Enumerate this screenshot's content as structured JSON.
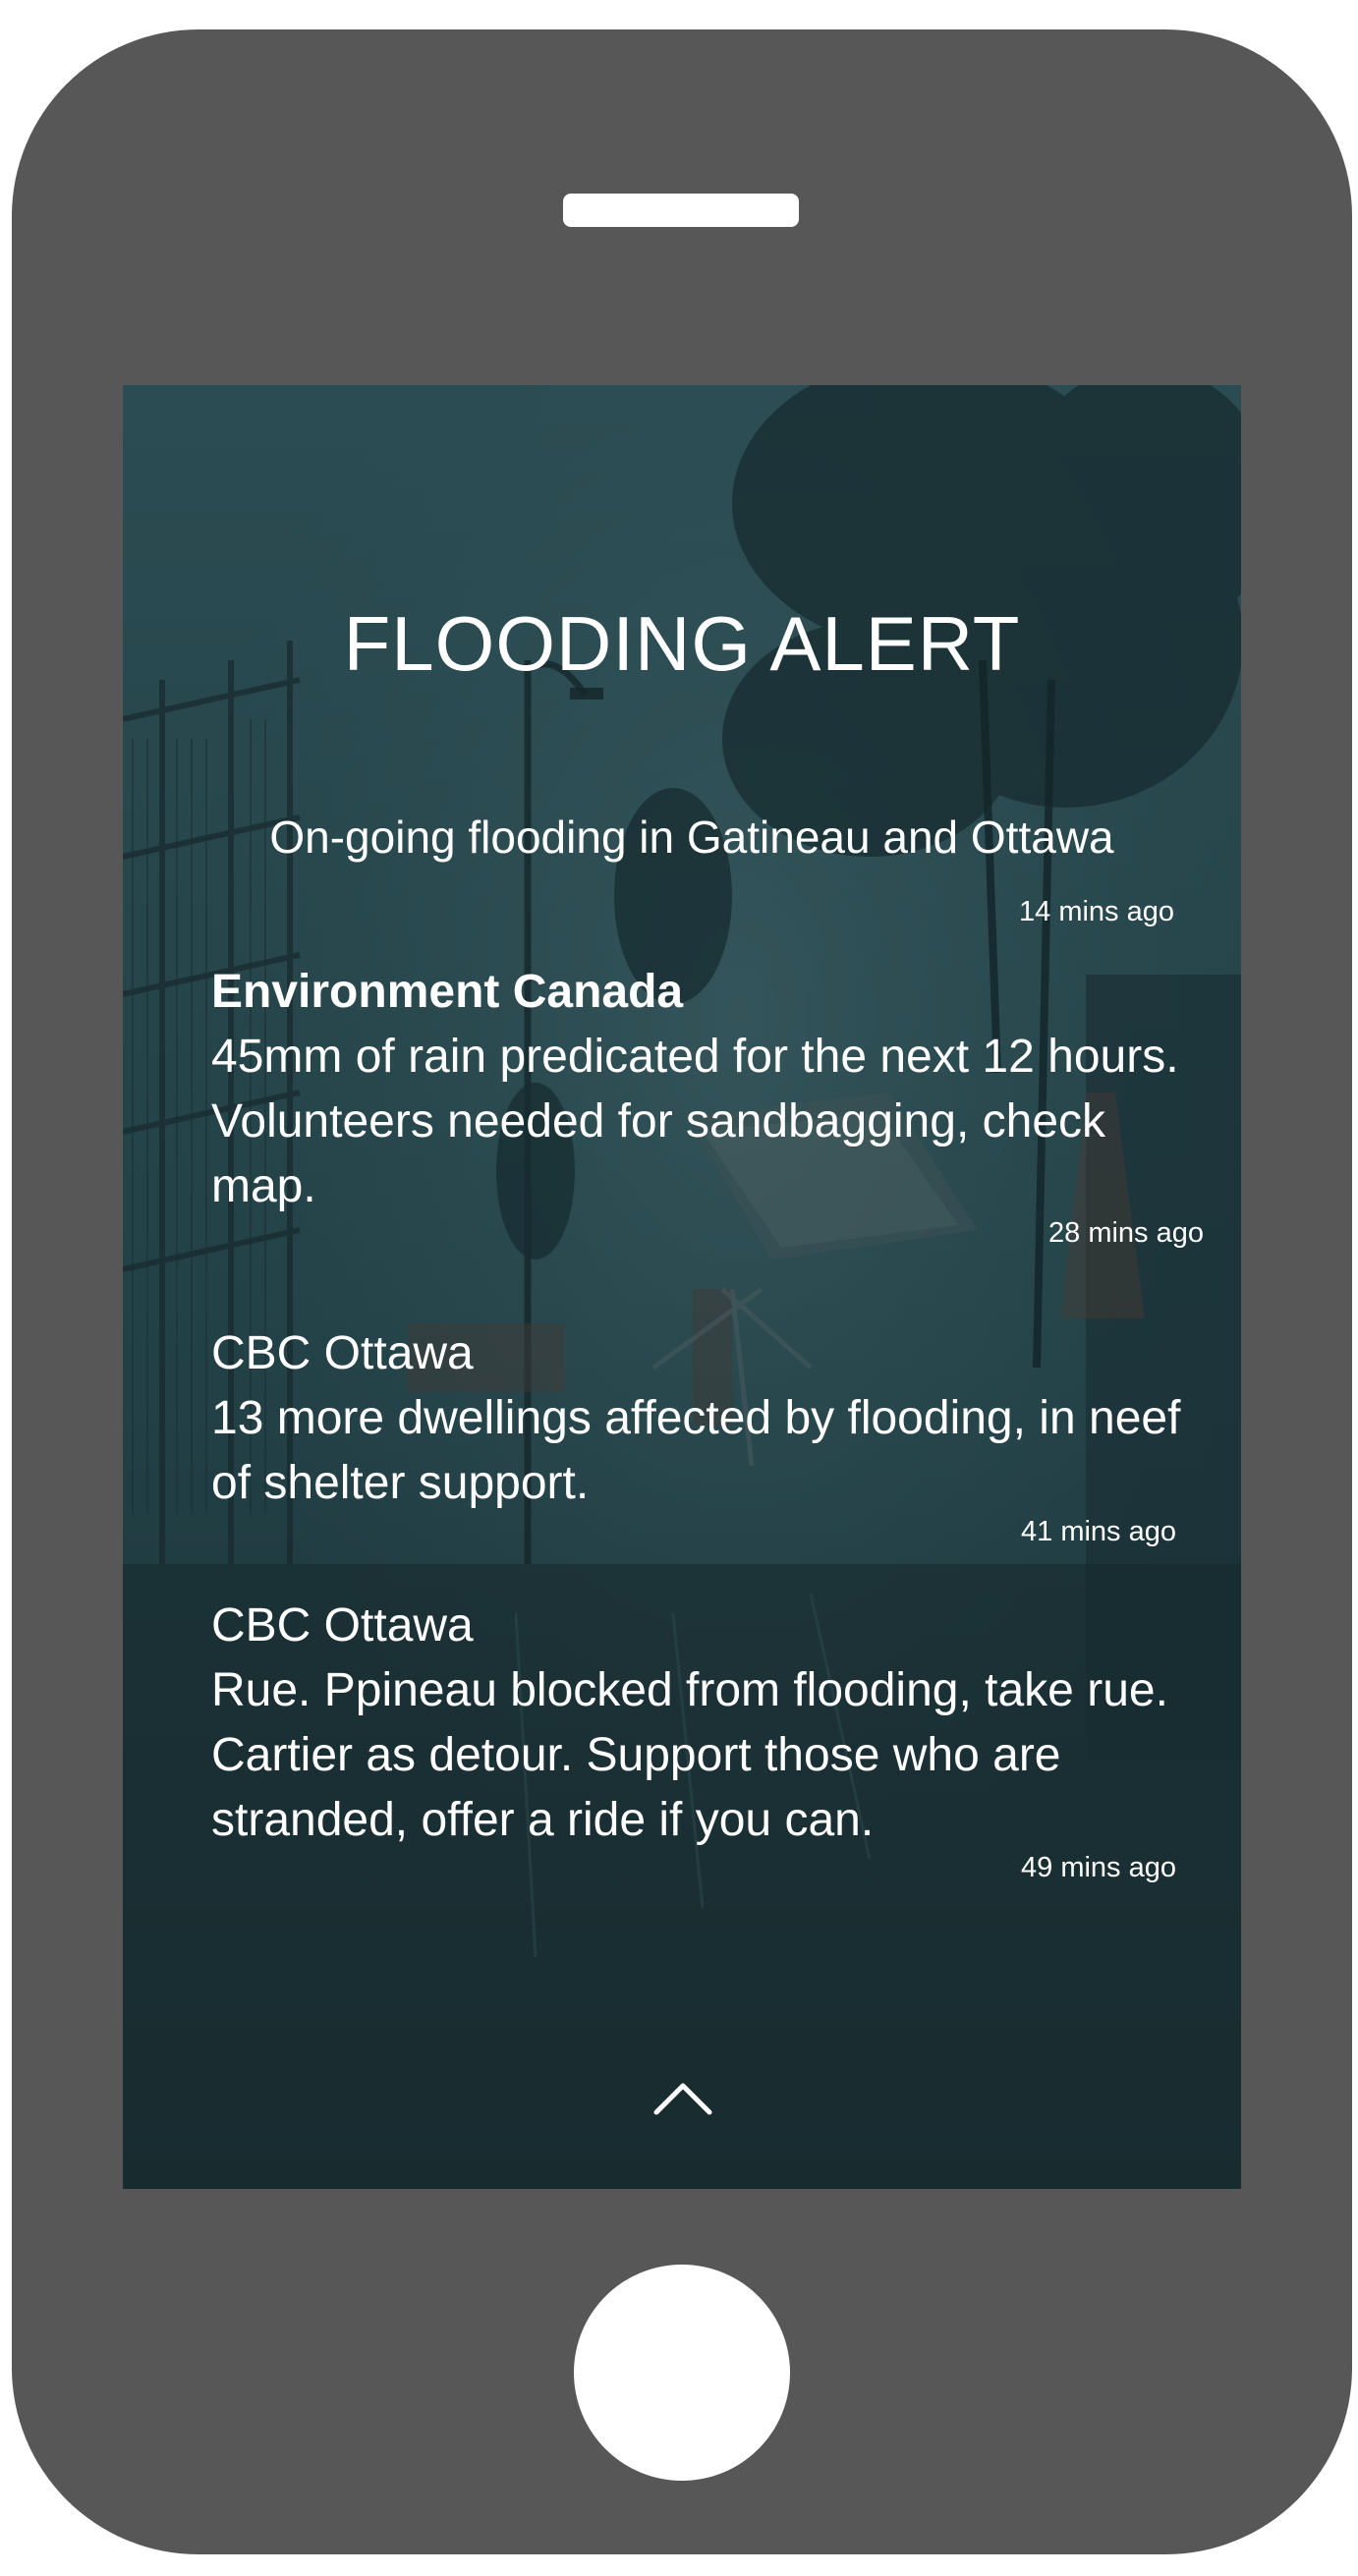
{
  "alert": {
    "title": "FLOODING ALERT",
    "headline": "On-going flooding in Gatineau and Ottawa",
    "headline_time": "14 mins ago"
  },
  "feed": [
    {
      "source": "Environment Canada",
      "body": "45mm of rain predicated for the next 12 hours. Volunteers needed for sandbagging, check map.",
      "time": "28 mins ago"
    },
    {
      "source": "CBC Ottawa",
      "body": "13 more dwellings affected by flooding, in neef of shelter support.",
      "time": "41 mins ago"
    },
    {
      "source": "CBC Ottawa",
      "body": "Rue. Ppineau blocked from flooding, take rue. Cartier as detour. Support those who are stranded, offer a ride if you can.",
      "time": "49 mins ago"
    }
  ],
  "icons": {
    "expand": "chevron-up-icon"
  },
  "colors": {
    "phone_body": "#575757",
    "screen_overlay": "#1f3a40",
    "text": "#ffffff"
  }
}
